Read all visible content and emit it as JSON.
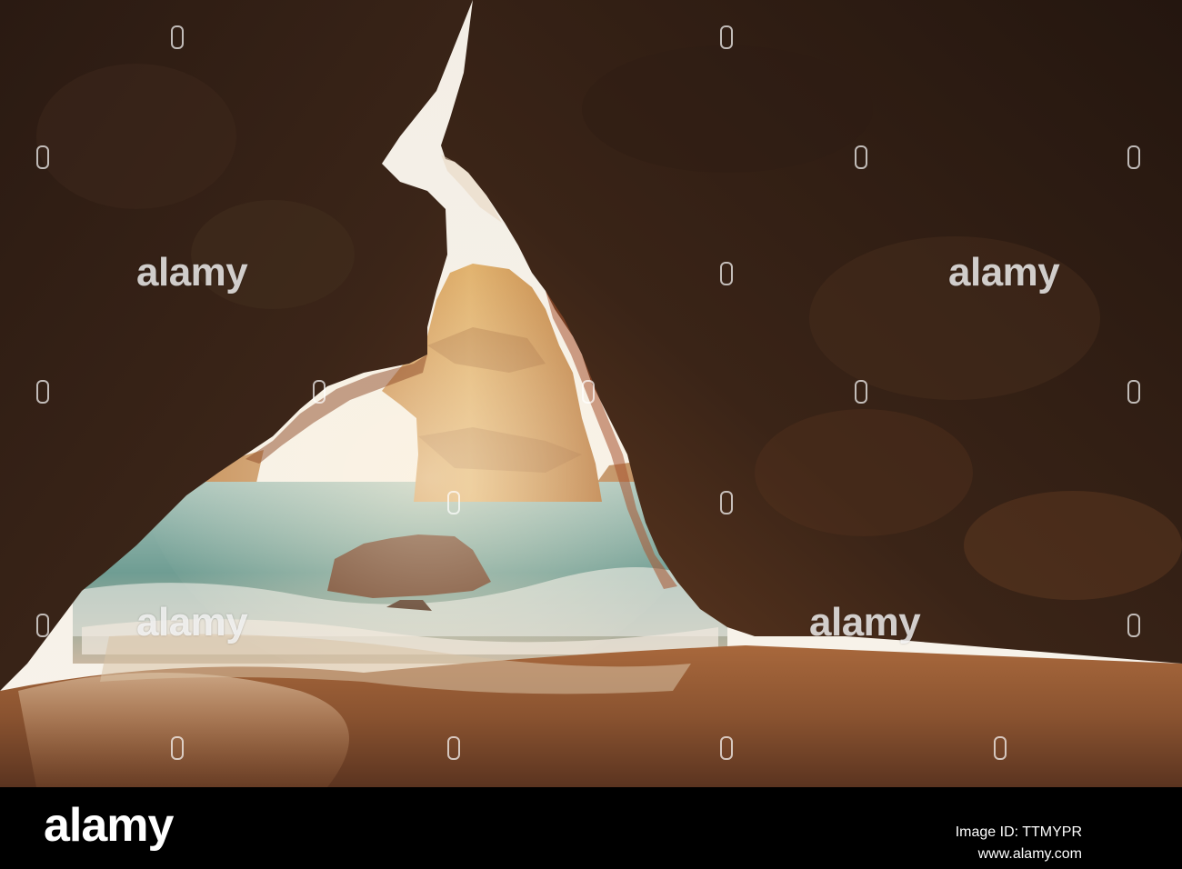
{
  "image": {
    "subject": "sea cave"
  },
  "watermark": {
    "text": "alamy"
  },
  "footer": {
    "logo": "alamy",
    "image_id": "Image ID: TTMYPR",
    "url": "www.alamy.com",
    "background_color": "#000000",
    "text_color": "#ffffff"
  }
}
